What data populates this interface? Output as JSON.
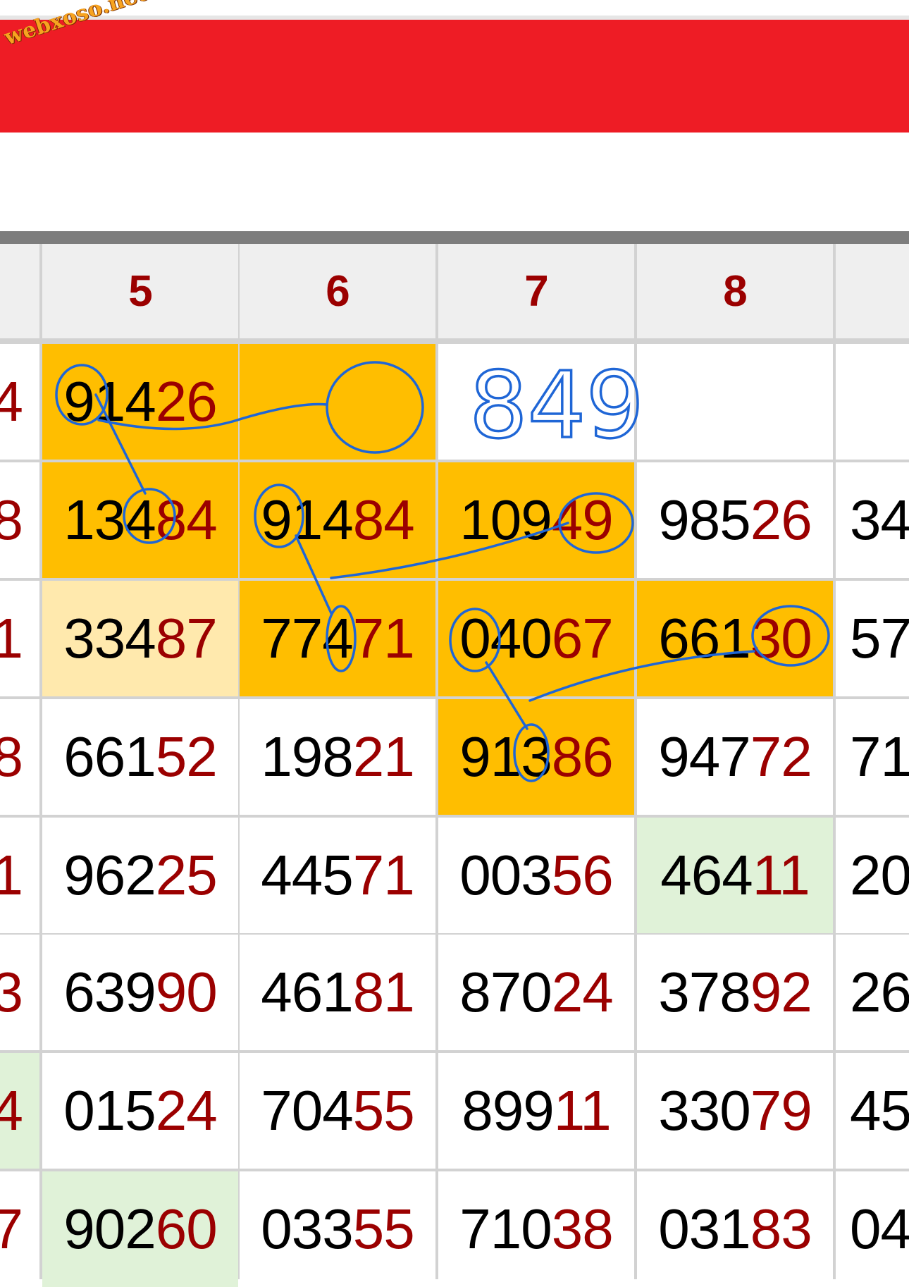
{
  "header": {
    "watermark_text": "webxoso.net",
    "columns": [
      "5",
      "6",
      "7",
      "8"
    ]
  },
  "annotation": {
    "handwritten_note": "849",
    "ink_color": "#1f66d6"
  },
  "colors": {
    "banner": "#ee1c25",
    "highlight": "#ffbe00",
    "highlight_light": "#ffe9ad",
    "highlight_green": "#e0f2d8",
    "tail_digits": "#9b0000",
    "header_text": "#9b0000"
  },
  "table": {
    "left_partial": [
      "4",
      "8",
      "1",
      "8",
      "1",
      "3",
      "4",
      "7"
    ],
    "right_partial": [
      "",
      "34",
      "57",
      "71",
      "20",
      "26",
      "45",
      "04"
    ],
    "rows": [
      [
        {
          "head": "914",
          "tail": "26",
          "hl": "hl"
        },
        {
          "head": "",
          "tail": "",
          "hl": "hl"
        },
        {
          "head": "",
          "tail": "",
          "hl": ""
        },
        {
          "head": "",
          "tail": "",
          "hl": ""
        }
      ],
      [
        {
          "head": "134",
          "tail": "84",
          "hl": "hl"
        },
        {
          "head": "914",
          "tail": "84",
          "hl": "hl"
        },
        {
          "head": "109",
          "tail": "49",
          "hl": "hl"
        },
        {
          "head": "985",
          "tail": "26",
          "hl": ""
        }
      ],
      [
        {
          "head": "334",
          "tail": "87",
          "hl": "hl-light"
        },
        {
          "head": "774",
          "tail": "71",
          "hl": "hl"
        },
        {
          "head": "040",
          "tail": "67",
          "hl": "hl"
        },
        {
          "head": "661",
          "tail": "30",
          "hl": "hl"
        }
      ],
      [
        {
          "head": "661",
          "tail": "52",
          "hl": ""
        },
        {
          "head": "198",
          "tail": "21",
          "hl": ""
        },
        {
          "head": "913",
          "tail": "86",
          "hl": "hl"
        },
        {
          "head": "947",
          "tail": "72",
          "hl": ""
        }
      ],
      [
        {
          "head": "962",
          "tail": "25",
          "hl": ""
        },
        {
          "head": "445",
          "tail": "71",
          "hl": ""
        },
        {
          "head": "003",
          "tail": "56",
          "hl": ""
        },
        {
          "head": "464",
          "tail": "11",
          "hl": "hl-green"
        }
      ],
      [
        {
          "head": "639",
          "tail": "90",
          "hl": ""
        },
        {
          "head": "461",
          "tail": "81",
          "hl": ""
        },
        {
          "head": "870",
          "tail": "24",
          "hl": ""
        },
        {
          "head": "378",
          "tail": "92",
          "hl": ""
        }
      ],
      [
        {
          "head": "015",
          "tail": "24",
          "hl": ""
        },
        {
          "head": "704",
          "tail": "55",
          "hl": ""
        },
        {
          "head": "899",
          "tail": "11",
          "hl": ""
        },
        {
          "head": "330",
          "tail": "79",
          "hl": ""
        }
      ],
      [
        {
          "head": "902",
          "tail": "60",
          "hl": "hl-green"
        },
        {
          "head": "033",
          "tail": "55",
          "hl": ""
        },
        {
          "head": "710",
          "tail": "38",
          "hl": ""
        },
        {
          "head": "031",
          "tail": "83",
          "hl": ""
        }
      ]
    ],
    "left_partial_hl": [
      "",
      "",
      "",
      "",
      "",
      "",
      "hl-green",
      ""
    ]
  }
}
